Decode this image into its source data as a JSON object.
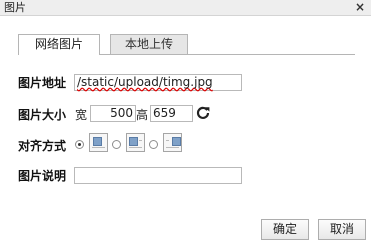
{
  "dialog": {
    "title": "图片",
    "close_label": "×"
  },
  "tabs": [
    {
      "label": "网络图片",
      "active": true
    },
    {
      "label": "本地上传",
      "active": false
    }
  ],
  "form": {
    "url_label": "图片地址",
    "url_value": "/static/upload/timg.jpg",
    "size_label": "图片大小",
    "width_label": "宽",
    "width_value": "500",
    "height_label": "高",
    "height_value": "659",
    "align_label": "对齐方式",
    "align_options": [
      "none",
      "left",
      "right"
    ],
    "align_selected": "none",
    "desc_label": "图片说明",
    "desc_value": ""
  },
  "buttons": {
    "ok": "确定",
    "cancel": "取消"
  },
  "icons": {
    "refresh": "refresh-icon",
    "close": "close-icon"
  }
}
